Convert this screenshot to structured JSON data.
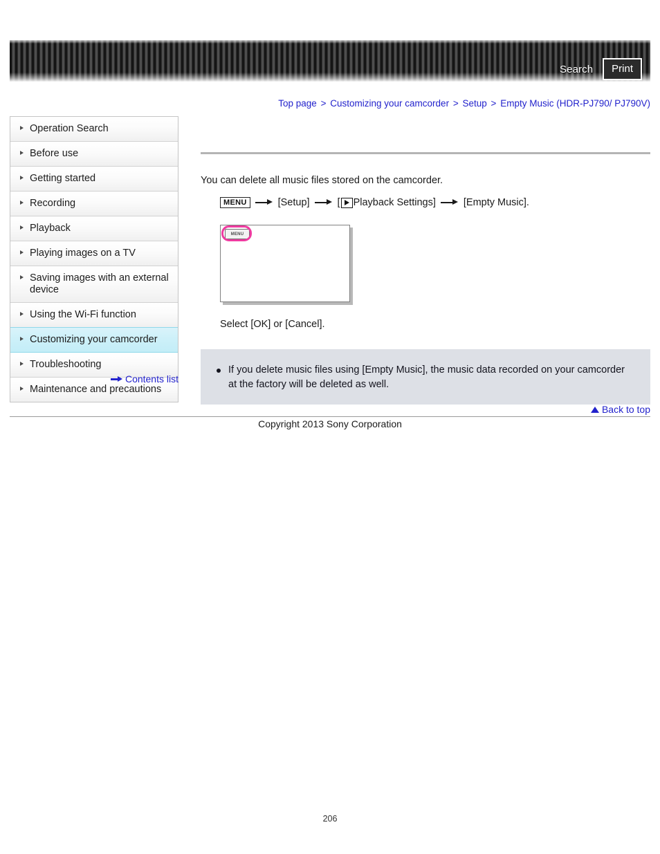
{
  "header": {
    "search_label": "Search",
    "print_label": "Print",
    "search_icon": "search-icon",
    "print_icon": "print-icon"
  },
  "breadcrumb": {
    "separator": ">",
    "items": [
      {
        "label": "Top page"
      },
      {
        "label": "Customizing your camcorder"
      },
      {
        "label": "Setup"
      },
      {
        "label": "Empty Music (HDR-PJ790/ PJ790V)"
      }
    ]
  },
  "sidebar": {
    "items": [
      {
        "label": "Operation Search",
        "active": false
      },
      {
        "label": "Before use",
        "active": false
      },
      {
        "label": "Getting started",
        "active": false
      },
      {
        "label": "Recording",
        "active": false
      },
      {
        "label": "Playback",
        "active": false
      },
      {
        "label": "Playing images on a TV",
        "active": false
      },
      {
        "label": "Saving images with an external device",
        "active": false
      },
      {
        "label": "Using the Wi-Fi function",
        "active": false
      },
      {
        "label": "Customizing your camcorder",
        "active": true
      },
      {
        "label": "Troubleshooting",
        "active": false
      },
      {
        "label": "Maintenance and precautions",
        "active": false
      }
    ],
    "contents_list_label": "Contents list",
    "contents_list_icon": "arrow-right-icon"
  },
  "main": {
    "intro": "You can delete all music files stored on the camcorder.",
    "menu_path": {
      "menu_button_label": "MENU",
      "step_setup": "[Setup]",
      "step_playback_prefix": "[",
      "step_playback_label": "Playback Settings]",
      "playback_icon": "playback-settings-icon",
      "step_empty_music": "[Empty Music].",
      "arrow_icon": "arrow-right-icon"
    },
    "illustration": {
      "menu_chip_label": "MENU",
      "highlight_color": "#ee3ba0",
      "name": "camcorder-screen-illustration"
    },
    "select_text": "Select [OK] or [Cancel].",
    "notes": [
      "If you delete music files using [Empty Music], the music data recorded on your camcorder at the factory will be deleted as well."
    ]
  },
  "footer": {
    "back_to_top_label": "Back to top",
    "back_to_top_icon": "triangle-up-icon",
    "copyright": "Copyright 2013 Sony Corporation",
    "page_number": "206"
  },
  "colors": {
    "link": "#2222cc",
    "accent_highlight": "#c3edf7",
    "note_bg": "#dde0e6",
    "magenta": "#ee3ba0"
  }
}
